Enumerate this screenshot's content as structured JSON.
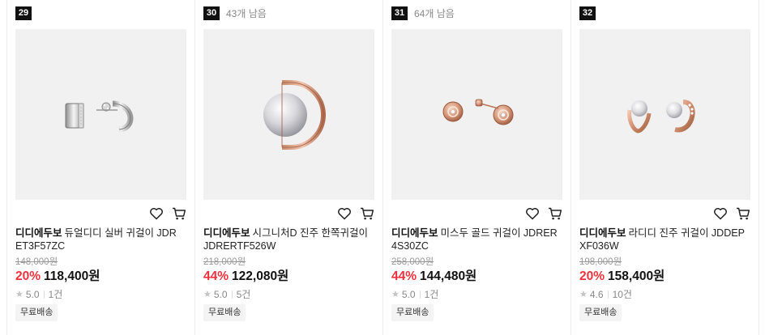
{
  "products": [
    {
      "rank": "29",
      "remaining": "",
      "brand": "디디에두보",
      "name": "듀얼디디 실버 귀걸이 JDRET3F57ZC",
      "original_price": "148,000원",
      "discount": "20%",
      "price": "118,400원",
      "rating": "5.0",
      "review_count": "1건",
      "badge": "무료배송",
      "image": "silver-dual-earring"
    },
    {
      "rank": "30",
      "remaining": "43개 남음",
      "brand": "디디에두보",
      "name": "시그니처D 진주 한쪽귀걸이 JDRERTF526W",
      "original_price": "218,000원",
      "discount": "44%",
      "price": "122,080원",
      "rating": "5.0",
      "review_count": "5건",
      "badge": "무료배송",
      "image": "pearl-d-earring"
    },
    {
      "rank": "31",
      "remaining": "64개 남음",
      "brand": "디디에두보",
      "name": "미스두 골드 귀걸이 JDRER4S30ZC",
      "original_price": "258,000원",
      "discount": "44%",
      "price": "144,480원",
      "rating": "5.0",
      "review_count": "1건",
      "badge": "무료배송",
      "image": "rose-gold-stud-earring"
    },
    {
      "rank": "32",
      "remaining": "",
      "brand": "디디에두보",
      "name": "라디디 진주 귀걸이 JDDEPXF036W",
      "original_price": "198,000원",
      "discount": "20%",
      "price": "158,400원",
      "rating": "4.6",
      "review_count": "10건",
      "badge": "무료배송",
      "image": "pearl-hoop-earring"
    }
  ],
  "icons": {
    "wishlist": "heart-icon",
    "cart": "cart-icon",
    "rating": "star-icon"
  },
  "colors": {
    "discount": "#f0313d",
    "rank_badge": "#111111",
    "thumb_bg": "#f1f1f1"
  }
}
